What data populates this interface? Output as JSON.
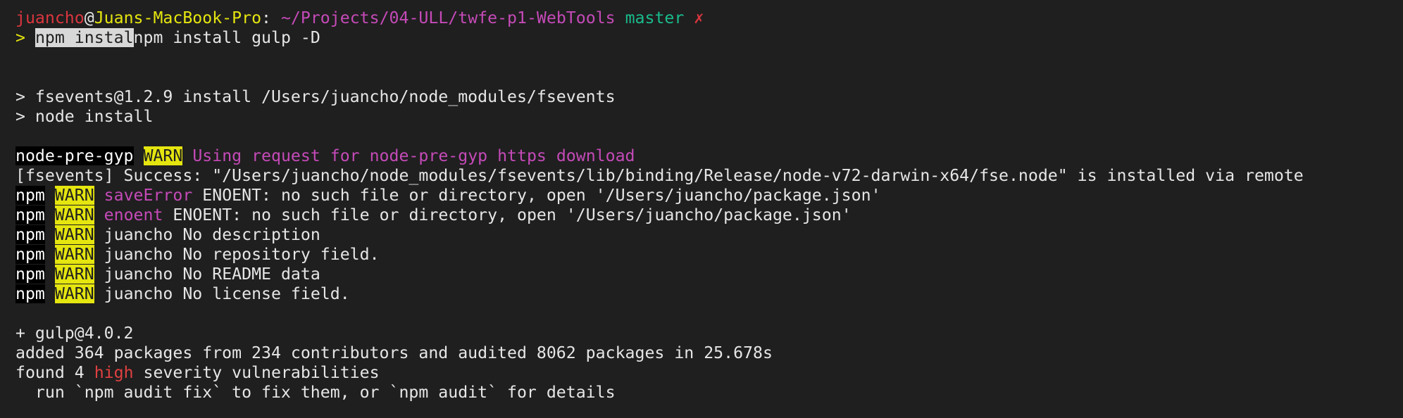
{
  "prompt": {
    "user": "juancho",
    "at": "@",
    "host": "Juans-MacBook-Pro",
    "colon": ":",
    "path": "~/Projects/04-ULL/twfe-p1-WebTools",
    "branch": "master",
    "dirty_mark": "✗"
  },
  "command": {
    "caret": ">",
    "selected": "npm instal",
    "rest": "npm install gulp -D"
  },
  "install_script": {
    "line1": "> fsevents@1.2.9 install /Users/juancho/node_modules/fsevents",
    "line2": "> node install"
  },
  "node_pre_gyp": {
    "tag": "node-pre-gyp",
    "level": "WARN",
    "message": "Using request for node-pre-gyp https download"
  },
  "fsevents_success": "[fsevents] Success: \"/Users/juancho/node_modules/fsevents/lib/binding/Release/node-v72-darwin-x64/fse.node\" is installed via remote",
  "warnings": [
    {
      "prefix": "npm",
      "level": "WARN",
      "code": "saveError",
      "message": "ENOENT: no such file or directory, open '/Users/juancho/package.json'"
    },
    {
      "prefix": "npm",
      "level": "WARN",
      "code": "enoent",
      "message": "ENOENT: no such file or directory, open '/Users/juancho/package.json'"
    },
    {
      "prefix": "npm",
      "level": "WARN",
      "code": "",
      "message": "juancho No description"
    },
    {
      "prefix": "npm",
      "level": "WARN",
      "code": "",
      "message": "juancho No repository field."
    },
    {
      "prefix": "npm",
      "level": "WARN",
      "code": "",
      "message": "juancho No README data"
    },
    {
      "prefix": "npm",
      "level": "WARN",
      "code": "",
      "message": "juancho No license field."
    }
  ],
  "summary": {
    "installed": "+ gulp@4.0.2",
    "added": "added 364 packages from 234 contributors and audited 8062 packages in 25.678s",
    "found_prefix": "found 4 ",
    "severity": "high",
    "found_suffix": " severity vulnerabilities",
    "advice": "  run `npm audit fix` to fix them, or `npm audit` for details"
  },
  "colors": {
    "background": "#1f1f1f",
    "foreground": "#e6e6e6",
    "user": "#d9363e",
    "host": "#e5e510",
    "path": "#c54ab8",
    "branch": "#1abc8c",
    "warn_bg": "#e5e510",
    "high": "#e04040"
  }
}
